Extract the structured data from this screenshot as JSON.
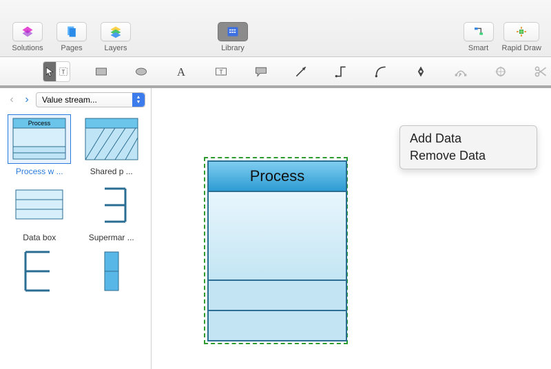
{
  "toolbar": {
    "solutions": "Solutions",
    "pages": "Pages",
    "layers": "Layers",
    "library": "Library",
    "smart": "Smart",
    "rapid_draw": "Rapid Draw"
  },
  "library": {
    "selected": "Value stream...",
    "stencils": [
      {
        "label": "Process w ..."
      },
      {
        "label": "Shared p ..."
      },
      {
        "label": "Data box"
      },
      {
        "label": "Supermar ..."
      }
    ]
  },
  "canvas": {
    "shape_title": "Process"
  },
  "context_menu": {
    "add": "Add Data",
    "remove": "Remove Data"
  },
  "thumb_header": "Process"
}
